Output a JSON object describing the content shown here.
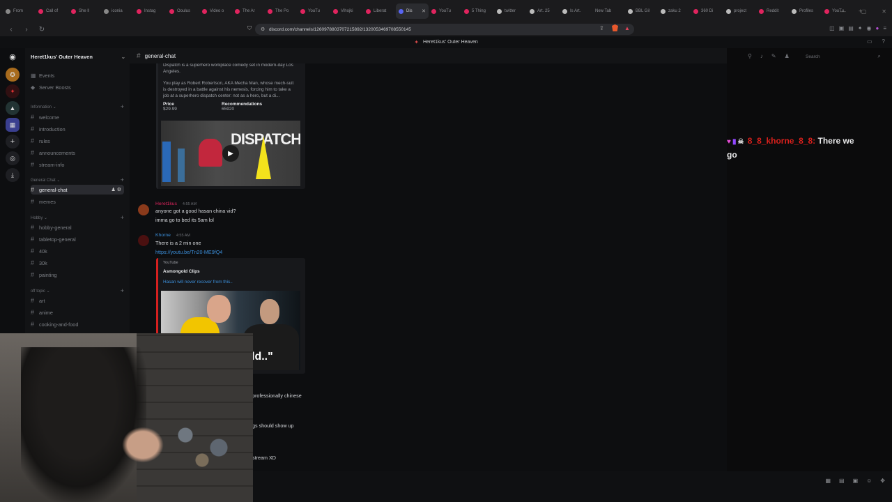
{
  "browser": {
    "tabs": [
      {
        "label": "From",
        "color": "#888"
      },
      {
        "label": "Call of",
        "color": "#e0245e"
      },
      {
        "label": "She ll",
        "color": "#e0245e"
      },
      {
        "label": "iconia",
        "color": "#888"
      },
      {
        "label": "Instag",
        "color": "#e0245e"
      },
      {
        "label": "Ooulus",
        "color": "#e0245e"
      },
      {
        "label": "Video o",
        "color": "#e0245e"
      },
      {
        "label": "The Ar",
        "color": "#e0245e"
      },
      {
        "label": "The Po",
        "color": "#e0245e"
      },
      {
        "label": "YouTu",
        "color": "#e0245e"
      },
      {
        "label": "Vihojki",
        "color": "#e0245e"
      },
      {
        "label": "Liberat",
        "color": "#e0245e"
      },
      {
        "label": "Dis",
        "color": "#5865f2",
        "active": true
      },
      {
        "label": "YouTu",
        "color": "#e0245e"
      },
      {
        "label": "5 Thing",
        "color": "#e0245e"
      },
      {
        "label": "twitter",
        "color": "#bbb"
      },
      {
        "label": "Art. 25",
        "color": "#bbb"
      },
      {
        "label": "Is Art.",
        "color": "#bbb"
      },
      {
        "label": "New Tab",
        "color": ""
      },
      {
        "label": "BBL Gil",
        "color": "#bbb"
      },
      {
        "label": "zaku 2",
        "color": "#bbb"
      },
      {
        "label": "360 Di",
        "color": "#e0245e"
      },
      {
        "label": "project",
        "color": "#bbb"
      },
      {
        "label": "Reddit",
        "color": "#e0245e"
      },
      {
        "label": "Profiles",
        "color": "#bbb"
      },
      {
        "label": "YouTu",
        "color": "#e0245e"
      }
    ],
    "url": "discord.com/channels/1260978803707215892/1320053469708550145"
  },
  "discord": {
    "window_title": "Heret1kus' Outer Heaven",
    "server_name": "Heret1kus' Outer Heaven",
    "top_items": [
      {
        "label": "Events",
        "icon": "calendar-icon"
      },
      {
        "label": "Server Boosts",
        "icon": "boost-icon"
      }
    ],
    "categories": {
      "information": "Information",
      "general": "General Chat",
      "hobby": "Hobby",
      "offtopic": "off topic"
    },
    "channels_information": [
      "welcome",
      "introduction",
      "rules",
      "announcements",
      "stream-info"
    ],
    "channels_general": [
      "general-chat",
      "memes"
    ],
    "channels_hobby": [
      "hobby-general",
      "tabletop-general",
      "40k",
      "30k",
      "painting"
    ],
    "channels_offtopic": [
      "art",
      "anime",
      "cooking-and-food"
    ],
    "current_channel": "general-chat",
    "search_placeholder": "Search"
  },
  "messages": {
    "embed1": {
      "desc_top": "Dispatch is a superhero workplace comedy set in modern-day Los Angeles.",
      "desc_1": "You play as Robert Robertson, AKA Mecha Man, whose mech-suit",
      "desc_2": "is destroyed in a battle against his nemesis, forcing him to take a",
      "desc_3": "job at a superhero dispatch center: not as a hero, but a di...",
      "price_label": "Price",
      "price_value": "$29.99",
      "rec_label": "Recommendations",
      "rec_value": "65920",
      "thumb_text": "DISPATCH"
    },
    "msg1": {
      "author": "Heret1kus",
      "author_color": "#e0245e",
      "time": "4:55 AM",
      "line1": "anyone got a good hasan china vid?",
      "line2": "imma go to bed its 5am lol"
    },
    "msg2": {
      "author": "Khorne",
      "author_color": "#3b8ed9",
      "time": "4:55 AM",
      "line1": "There is a 2 min one",
      "link": "https://youtu.be/Tn20-ME9fQ4"
    },
    "embed2": {
      "provider": "YouTube",
      "channel": "Asmongold Clips",
      "title": "Hasan will never recover from this..",
      "thumb_caption": "ld..\""
    },
    "partial1": "professionally chinese",
    "partial2": "gs should show up",
    "partial3": "stream XD"
  },
  "overlay": {
    "name": "8_8_khorne_8_8",
    "text_1": "There we",
    "text_2": "go"
  }
}
